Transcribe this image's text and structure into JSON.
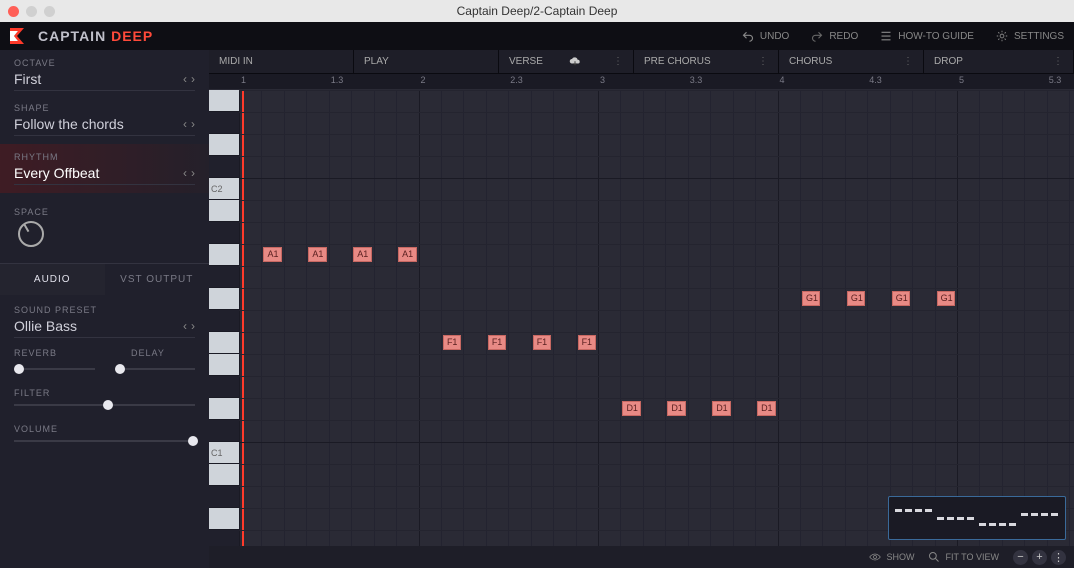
{
  "window": {
    "title": "Captain Deep/2-Captain Deep"
  },
  "brand": {
    "name1": "CAPTAIN",
    "name2": "DEEP"
  },
  "topActions": {
    "undo": "UNDO",
    "redo": "REDO",
    "guide": "HOW-TO GUIDE",
    "settings": "SETTINGS"
  },
  "params": {
    "octave": {
      "label": "OCTAVE",
      "value": "First"
    },
    "shape": {
      "label": "SHAPE",
      "value": "Follow the chords"
    },
    "rhythm": {
      "label": "RHYTHM",
      "value": "Every Offbeat"
    },
    "space": {
      "label": "SPACE"
    }
  },
  "tabs": {
    "audio": "AUDIO",
    "vst": "VST  OUTPUT"
  },
  "sound": {
    "presetLabel": "SOUND PRESET",
    "preset": "Ollie Bass",
    "reverb": "REVERB",
    "delay": "DELAY",
    "filter": "FILTER",
    "volume": "VOLUME"
  },
  "sections": {
    "midiIn": "MIDI IN",
    "play": "PLAY",
    "verse": "VERSE",
    "preChorus": "PRE CHORUS",
    "chorus": "CHORUS",
    "drop": "DROP"
  },
  "ruler": [
    "1",
    "1.3",
    "2",
    "2.3",
    "3",
    "3.3",
    "4",
    "4.3",
    "5",
    "5.3"
  ],
  "keyLabels": {
    "c2": "C2",
    "c1": "C1"
  },
  "notes": {
    "a1": "A1",
    "g1": "G1",
    "f1": "F1",
    "d1": "D1"
  },
  "bottomBar": {
    "show": "SHOW",
    "fit": "FIT TO VIEW"
  }
}
